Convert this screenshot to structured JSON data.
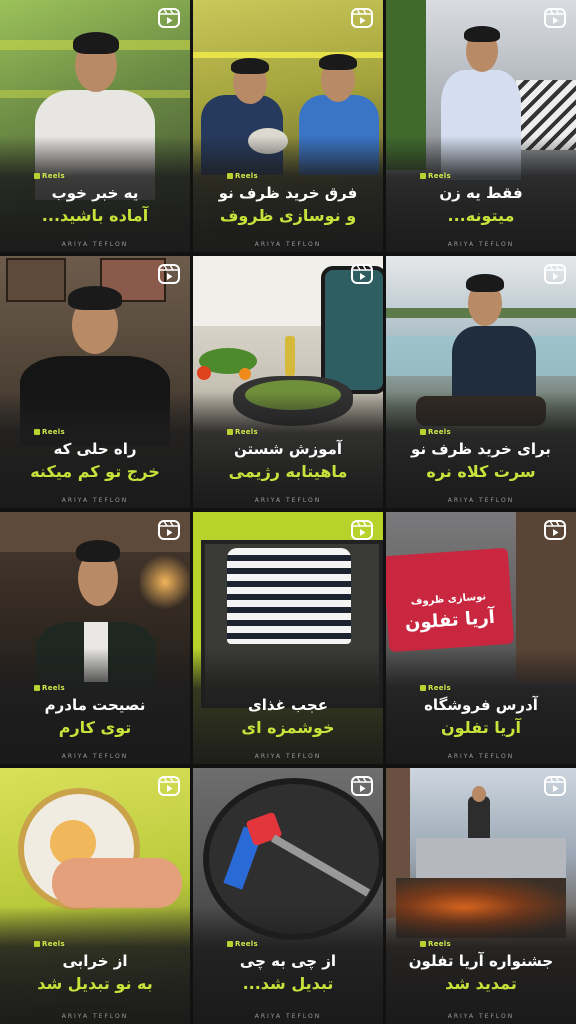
{
  "brand": "ARIYA TEFLON",
  "reels_tag": "Reels",
  "tiles": [
    {
      "line1": "یه خبر خوب",
      "line2": "آماده باشید...",
      "bg": "#6f8f4a"
    },
    {
      "line1": "فرق خرید ظرف نو",
      "line2": "و نوسازی ظروف",
      "bg": "#8d8a3a"
    },
    {
      "line1": "فقط یه زن",
      "line2": "میتونه...",
      "bg": "#8a8f96"
    },
    {
      "line1": "راه حلی که",
      "line2": "خرج تو کم میکنه",
      "bg": "#6b5a4a"
    },
    {
      "line1": "آموزش شستن",
      "line2": "ماهیتابه رژیمی",
      "bg": "#b9b3a6"
    },
    {
      "line1": "برای خرید ظرف نو",
      "line2": "سرت کلاه نره",
      "bg": "#8fa3ad"
    },
    {
      "line1": "نصیحت مادرم",
      "line2": "توی کارم",
      "bg": "#3b2e26"
    },
    {
      "line1": "عجب غذای",
      "line2": "خوشمزه ای",
      "bg": "#b6d12a"
    },
    {
      "line1": "آدرس فروشگاه",
      "line2": "آریا تفلون",
      "bg": "#6e6e70"
    },
    {
      "line1": "از خرابی",
      "line2": "به نو تبدیل شد",
      "bg": "#c6d23a"
    },
    {
      "line1": "از چی به چی",
      "line2": "تبدیل شد...",
      "bg": "#6a6a6a"
    },
    {
      "line1": "جشنواره آریا تفلون",
      "line2": "تمدید شد",
      "bg": "#9aa6b4"
    }
  ],
  "sign_text": "آریا تفلون",
  "sign_small": "نوسازی ظروف"
}
